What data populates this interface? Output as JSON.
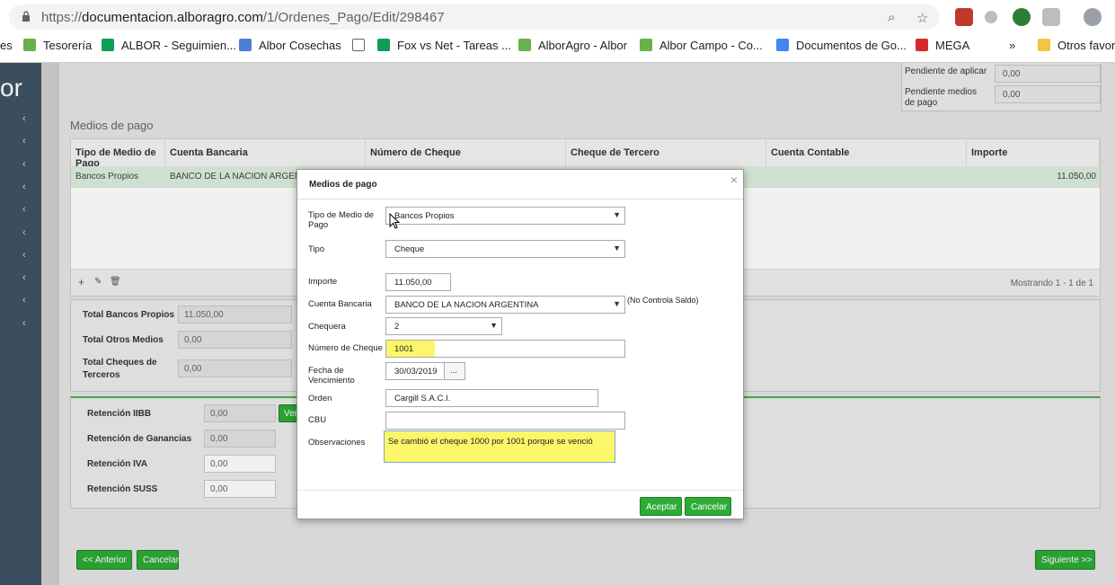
{
  "browser": {
    "url_prefix": "https://",
    "url_host": "documentacion.alboragro.com",
    "url_path": "/1/Ordenes_Pago/Edit/298467",
    "bookmarks": [
      {
        "label": "es",
        "color": "#ffffff"
      },
      {
        "label": "Tesorería",
        "color": "#6ab04c"
      },
      {
        "label": "ALBOR - Seguimien...",
        "color": "#0f9d58"
      },
      {
        "label": "Albor Cosechas",
        "color": "#4a7fd6"
      },
      {
        "label": "",
        "color": "#ffffff"
      },
      {
        "label": "Fox vs Net - Tareas ...",
        "color": "#0f9d58"
      },
      {
        "label": "AlborAgro - Albor",
        "color": "#6ab04c"
      },
      {
        "label": "Albor Campo - Co...",
        "color": "#6ab04c"
      },
      {
        "label": "Documentos de Go...",
        "color": "#4285f4"
      },
      {
        "label": "MEGA",
        "color": "#d9272e"
      },
      {
        "label": "»",
        "color": "#ffffff"
      },
      {
        "label": "Otros favorit",
        "color": "#f4c542"
      }
    ]
  },
  "sidebar": {
    "brand": "or"
  },
  "summary": {
    "pendiente_aplicar_label": "Pendiente de aplicar",
    "pendiente_aplicar_value": "0,00",
    "pendiente_medios_label": "Pendiente medios de pago",
    "pendiente_medios_value": "0,00"
  },
  "medios": {
    "title": "Medios de pago",
    "columns": [
      "Tipo de Medio de Pago",
      "Cuenta Bancaria",
      "Número de Cheque",
      "Cheque de Tercero",
      "Cuenta Contable",
      "Importe"
    ],
    "row": {
      "tipo": "Bancos Propios",
      "cuenta": "BANCO DE LA NACION ARGENTINA",
      "importe": "11.050,00"
    },
    "pager": "Mostrando 1 - 1 de 1"
  },
  "totals": {
    "bancos_label": "Total Bancos Propios",
    "bancos_value": "11.050,00",
    "otros_label": "Total Otros Medios",
    "otros_value": "0,00",
    "terceros_label": "Total Cheques de Terceros",
    "terceros_value": "0,00"
  },
  "retenciones": {
    "iibb_label": "Retención IIBB",
    "iibb_value": "0,00",
    "ver_label": "Ver",
    "ganancias_label": "Retención de Ganancias",
    "ganancias_value": "0,00",
    "iva_label": "Retención IVA",
    "iva_value": "0,00",
    "suss_label": "Retención SUSS",
    "suss_value": "0,00"
  },
  "nav": {
    "anterior": "<< Anterior",
    "cancelar": "Cancelar",
    "siguiente": "Siguiente >>"
  },
  "modal": {
    "title": "Medios de pago",
    "close": "×",
    "tipo_medio_label": "Tipo de Medio de Pago",
    "tipo_medio_value": "Bancos Propios",
    "tipo_label": "Tipo",
    "tipo_value": "Cheque",
    "importe_label": "Importe",
    "importe_value": "11.050,00",
    "cuenta_label": "Cuenta Bancaria",
    "cuenta_value": "BANCO DE LA NACION ARGENTINA",
    "cuenta_note": "(No Controla Saldo)",
    "chequera_label": "Chequera",
    "chequera_value": "2",
    "numero_label": "Número de Cheque",
    "numero_value": "1001",
    "fecha_label": "Fecha de Vencimiento",
    "fecha_value": "30/03/2019",
    "fecha_btn": "...",
    "orden_label": "Orden",
    "orden_value": "Cargill S.A.C.I.",
    "cbu_label": "CBU",
    "cbu_value": "",
    "obs_label": "Observaciones",
    "obs_value": "Se cambió el cheque 1000 por 1001 porque se venció",
    "aceptar": "Aceptar",
    "cancelar": "Cancelar"
  }
}
